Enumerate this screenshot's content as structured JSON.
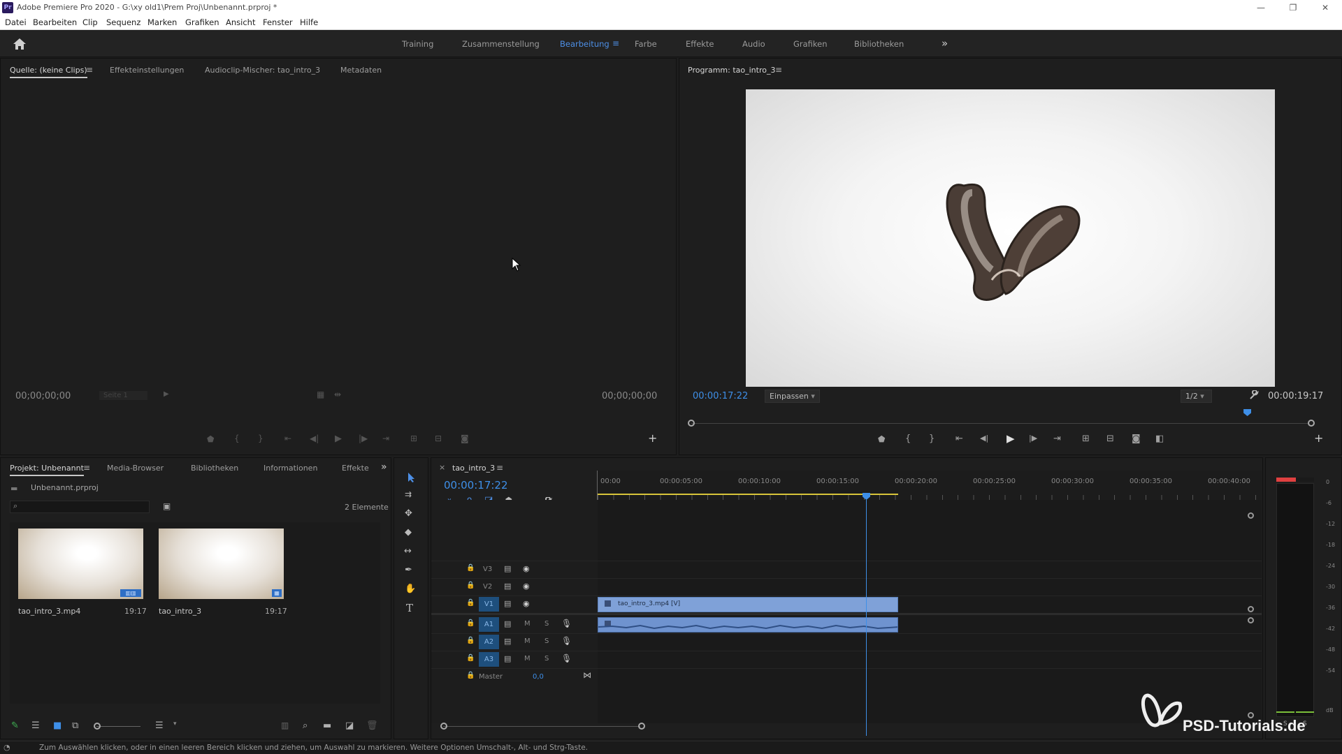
{
  "app": {
    "logo": "Pr",
    "title": "Adobe Premiere Pro 2020 - G:\\xy old1\\Prem Proj\\Unbenannt.prproj *"
  },
  "window_controls": {
    "minimize": "—",
    "restore": "❐",
    "close": "✕"
  },
  "menu": [
    "Datei",
    "Bearbeiten",
    "Clip",
    "Sequenz",
    "Marken",
    "Grafiken",
    "Ansicht",
    "Fenster",
    "Hilfe"
  ],
  "workspaces": {
    "tabs": [
      "Training",
      "Zusammenstellung",
      "Bearbeitung",
      "Farbe",
      "Effekte",
      "Audio",
      "Grafiken",
      "Bibliotheken"
    ],
    "active": "Bearbeitung",
    "overflow": "»"
  },
  "source_panel": {
    "tabs": [
      "Quelle: (keine Clips)",
      "Effekteinstellungen",
      "Audioclip-Mischer: tao_intro_3",
      "Metadaten"
    ],
    "active_tab": "Quelle: (keine Clips)",
    "timecode_left": "00;00;00;00",
    "page": "Seite 1",
    "timecode_right": "00;00;00;00"
  },
  "program_panel": {
    "title": "Programm: tao_intro_3",
    "timecode": "00:00:17:22",
    "zoom": "Einpassen",
    "resolution": "1/2",
    "duration": "00:00:19:17",
    "playhead_fraction": 0.9
  },
  "project_panel": {
    "tabs": [
      "Projekt: Unbenannt",
      "Media-Browser",
      "Bibliotheken",
      "Informationen",
      "Effekte"
    ],
    "active_tab": "Projekt: Unbenannt",
    "project_file": "Unbenannt.prproj",
    "item_count": "2 Elemente",
    "items": [
      {
        "name": "tao_intro_3.mp4",
        "duration": "19:17"
      },
      {
        "name": "tao_intro_3",
        "duration": "19:17"
      }
    ]
  },
  "timeline": {
    "sequence_tab": "tao_intro_3",
    "timecode": "00:00:17:22",
    "ruler": [
      "00:00",
      "00:00:05:00",
      "00:00:10:00",
      "00:00:15:00",
      "00:00:20:00",
      "00:00:25:00",
      "00:00:30:00",
      "00:00:35:00",
      "00:00:40:00"
    ],
    "video_tracks": [
      "V3",
      "V2",
      "V1"
    ],
    "audio_tracks": [
      "A1",
      "A2",
      "A3"
    ],
    "track_buttons": {
      "mute": "M",
      "solo": "S"
    },
    "master_label": "Master",
    "master_value": "0,0",
    "clip_video_label": "tao_intro_3.mp4 [V]"
  },
  "audio_meter": {
    "labels": [
      "0",
      "-6",
      "-12",
      "-18",
      "-24",
      "-30",
      "-36",
      "-42",
      "-48",
      "-54",
      "dB"
    ],
    "solo_labels": [
      "S",
      "S"
    ]
  },
  "watermark": "PSD-Tutorials.de",
  "status_text": "Zum Auswählen klicken, oder in einen leeren Bereich klicken und ziehen, um Auswahl zu markieren. Weitere Optionen Umschalt-, Alt- und Strg-Taste.",
  "colors": {
    "accent_blue": "#3e8fe8",
    "clip_blue": "#7fa1d8",
    "meter_red": "#e04040",
    "in_out_yellow": "#d8c43a"
  }
}
